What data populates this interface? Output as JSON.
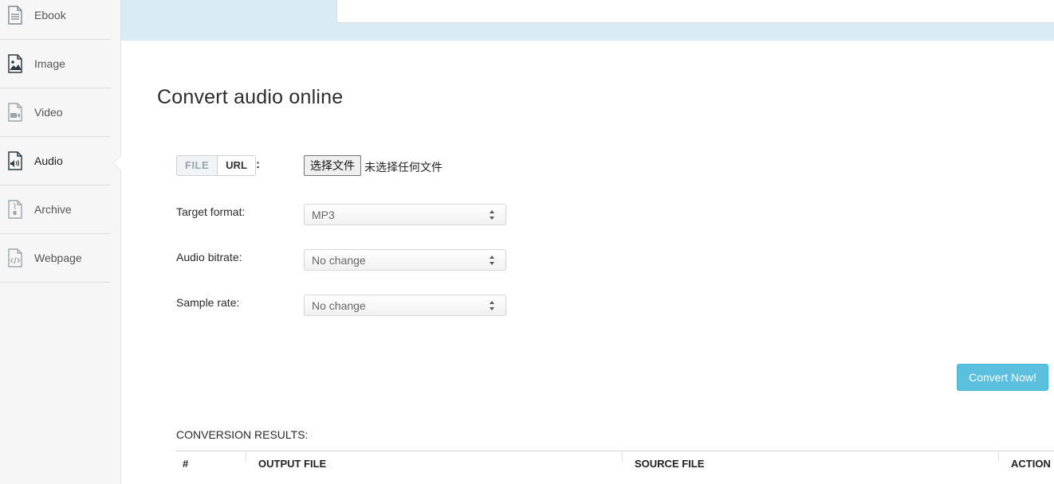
{
  "sidebar": {
    "items": [
      {
        "label": "Ebook",
        "icon": "ebook-icon"
      },
      {
        "label": "Image",
        "icon": "image-icon"
      },
      {
        "label": "Video",
        "icon": "video-icon"
      },
      {
        "label": "Audio",
        "icon": "audio-icon",
        "active": true
      },
      {
        "label": "Archive",
        "icon": "archive-icon"
      },
      {
        "label": "Webpage",
        "icon": "webpage-icon"
      }
    ]
  },
  "main": {
    "title": "Convert audio online",
    "source_toggle": {
      "file_label": "FILE",
      "url_label": "URL",
      "colon": ":"
    },
    "file_input": {
      "button_label": "选择文件",
      "status": "未选择任何文件"
    },
    "fields": {
      "target_format": {
        "label": "Target format:",
        "value": "MP3"
      },
      "audio_bitrate": {
        "label": "Audio bitrate:",
        "value": "No change"
      },
      "sample_rate": {
        "label": "Sample rate:",
        "value": "No change"
      }
    },
    "convert_button": "Convert Now!",
    "results": {
      "title": "CONVERSION RESULTS:",
      "columns": [
        "#",
        "OUTPUT FILE",
        "SOURCE FILE",
        "ACTION"
      ]
    }
  },
  "colors": {
    "accent": "#5bc0de",
    "top_band": "#d9ecf5",
    "sidebar_bg": "#f6f6f6"
  }
}
